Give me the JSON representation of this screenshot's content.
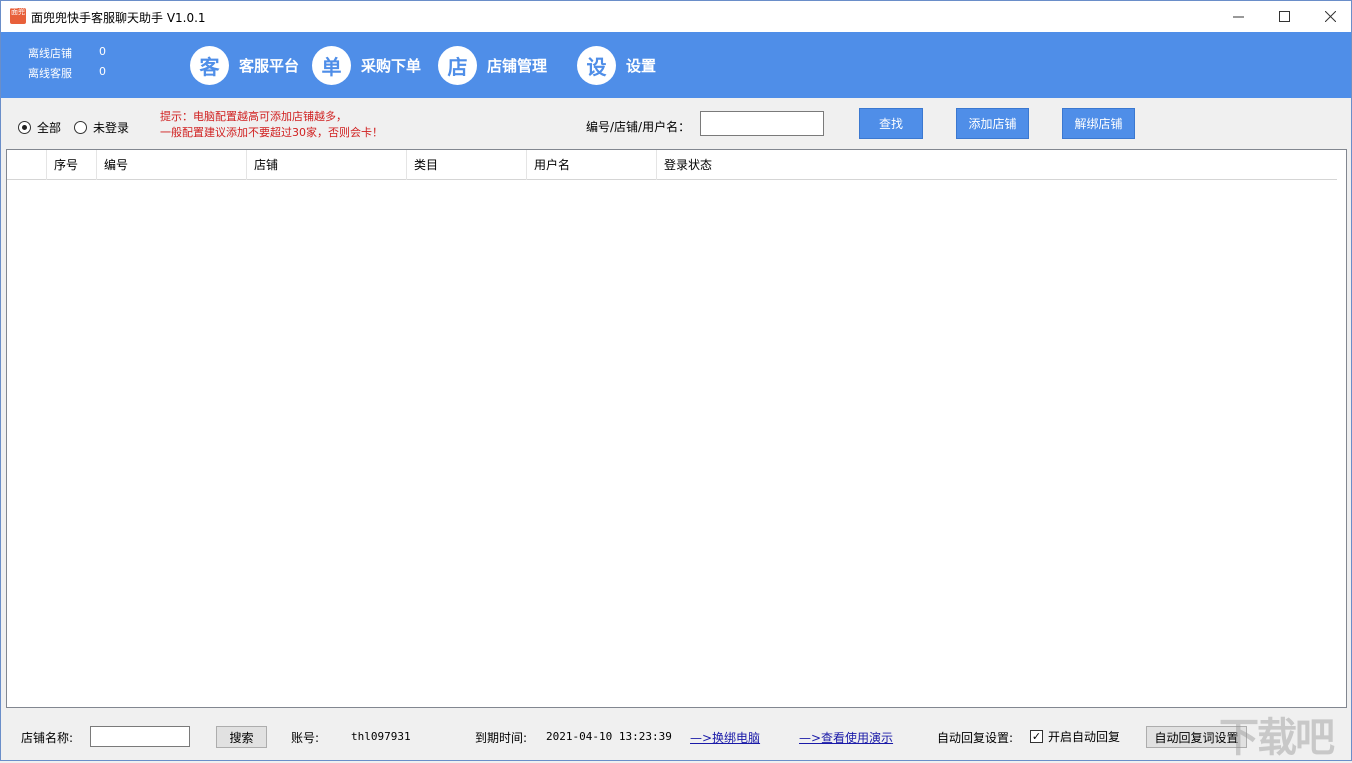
{
  "window": {
    "title": "面兜兜快手客服聊天助手 V1.0.1",
    "icon_text": "面兜",
    "controls": {
      "minimize": "—",
      "maximize": "☐",
      "close": "✕"
    }
  },
  "header": {
    "stats": [
      {
        "label": "离线店铺",
        "value": "0"
      },
      {
        "label": "离线客服",
        "value": "0"
      }
    ],
    "nav": [
      {
        "glyph": "客",
        "label": "客服平台"
      },
      {
        "glyph": "单",
        "label": "采购下单"
      },
      {
        "glyph": "店",
        "label": "店铺管理"
      },
      {
        "glyph": "设",
        "label": "设置"
      }
    ]
  },
  "filter": {
    "radios": [
      {
        "label": "全部",
        "checked": true
      },
      {
        "label": "未登录",
        "checked": false
      }
    ],
    "hint_line1": "提示：电脑配置越高可添加店铺越多，",
    "hint_line2": "一般配置建议添加不要超过30家，否则会卡！",
    "search_label": "编号/店铺/用户名：",
    "search_value": "",
    "find_button": "查找",
    "add_button": "添加店铺",
    "unbind_button": "解绑店铺"
  },
  "table": {
    "columns": [
      "",
      "序号",
      "编号",
      "店铺",
      "类目",
      "用户名",
      "登录状态"
    ],
    "rows": []
  },
  "footer": {
    "shop_name_label": "店铺名称:",
    "shop_name_value": "",
    "search_button": "搜索",
    "account_label": "账号:",
    "account_value": "thl097931",
    "expire_label": "到期时间:",
    "expire_value": "2021-04-10 13:23:39",
    "link_change_pc": "—>换绑电脑",
    "link_demo": "—>查看使用演示",
    "auto_reply_label": "自动回复设置:",
    "auto_reply_checkbox": "开启自动回复",
    "auto_reply_checked": true,
    "auto_reply_button": "自动回复词设置",
    "watermark": "下载吧"
  },
  "colors": {
    "header_blue": "#4f8ee8",
    "hint_red": "#d02020",
    "link_blue": "#1a1aa8"
  }
}
